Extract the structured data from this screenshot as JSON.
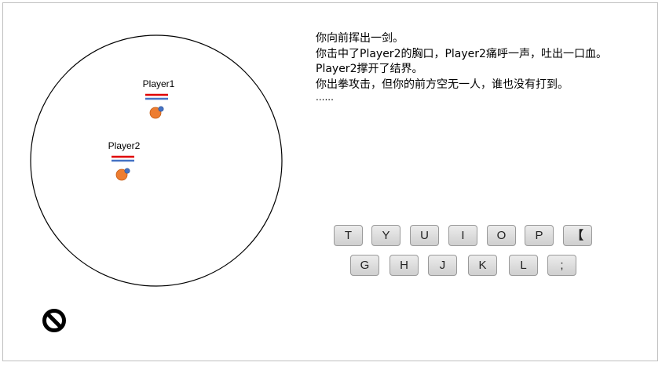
{
  "arena": {
    "players": [
      {
        "name": "Player1",
        "body_color": "#ed7d31",
        "weapon_color": "#4472c4",
        "bar_red": "#e00000",
        "bar_blue": "#4472c4"
      },
      {
        "name": "Player2",
        "body_color": "#ed7d31",
        "weapon_color": "#4472c4",
        "bar_red": "#e00000",
        "bar_blue": "#4472c4"
      }
    ]
  },
  "log": {
    "lines": [
      "你向前挥出一剑。",
      "你击中了Player2的胸口，Player2痛呼一声，吐出一口血。",
      "Player2撑开了结界。",
      "你出拳攻击，但你的前方空无一人，谁也没有打到。",
      "......"
    ]
  },
  "keyboard": {
    "row1": [
      "T",
      "Y",
      "U",
      "I",
      "O",
      "P",
      "【"
    ],
    "row2": [
      "G",
      "H",
      "J",
      "K",
      "L",
      ";"
    ]
  },
  "icons": {
    "prohibited": "no-entry-icon"
  }
}
